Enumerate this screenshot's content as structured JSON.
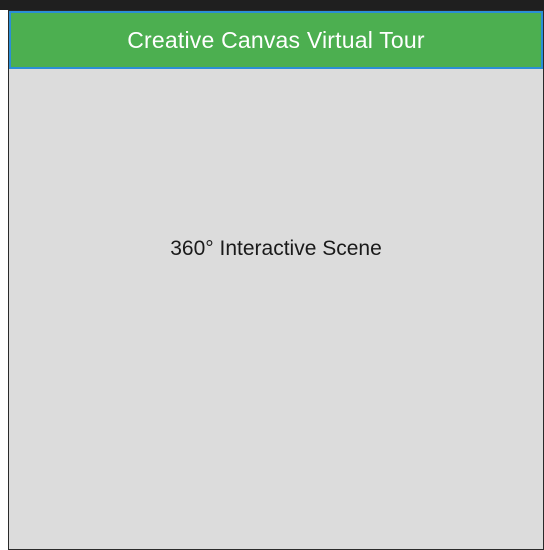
{
  "app": {
    "title": "Creative Canvas Virtual Tour"
  },
  "scene": {
    "label": "360° Interactive Scene"
  },
  "colors": {
    "title_bar_bg": "#4caf50",
    "title_bar_border": "#2b8fd6",
    "scene_bg": "#dcdcdc",
    "title_text": "#ffffff",
    "scene_text": "#1a1a1a"
  }
}
